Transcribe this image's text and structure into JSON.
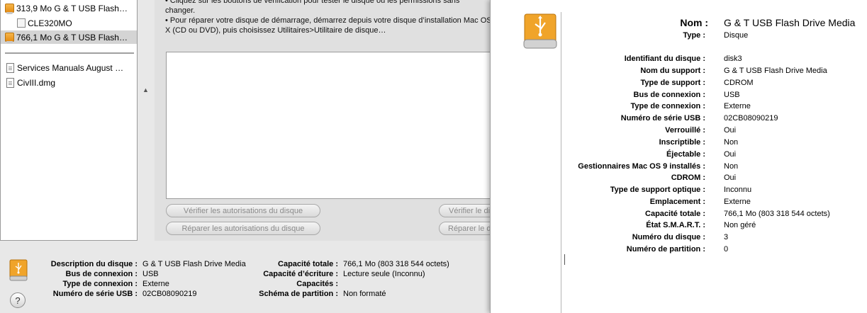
{
  "sidebar": {
    "items": [
      {
        "label": "313,9 Mo G & T USB Flash…",
        "icon": "usb-drive-icon",
        "selected": false
      },
      {
        "label": "CLE320MO",
        "icon": "volume-icon",
        "selected": false
      },
      {
        "label": "766,1 Mo G & T USB Flash…",
        "icon": "usb-drive-icon",
        "selected": true
      },
      {
        "label": "Services Manuals August …",
        "icon": "document-icon",
        "selected": false
      },
      {
        "label": "CivIII.dmg",
        "icon": "disk-image-icon",
        "selected": false
      }
    ]
  },
  "instructions": {
    "line1": "• Cliquez sur les boutons de vérification pour tester le disque ou les permissions sans",
    "line2": "changer.",
    "line3": "• Pour  réparer votre disque de démarrage, démarrez depuis votre disque d’installation Mac OS",
    "line4": "X (CD ou DVD), puis choisissez Utilitaires>Utilitaire de disque…"
  },
  "buttons": {
    "verify_permissions": "Vérifier les autorisations du disque",
    "repair_permissions": "Réparer les autorisations du disque",
    "verify_disk": "Vérifier le disque",
    "repair_disk": "Réparer le disque",
    "help": "?"
  },
  "bottom_info": {
    "description_label": "Description du disque :",
    "description_value": "G & T USB Flash Drive Media",
    "bus_label": "Bus de connexion :",
    "bus_value": "USB",
    "connection_label": "Type de connexion :",
    "connection_value": "Externe",
    "serial_label": "Numéro de série USB :",
    "serial_value": "02CB08090219",
    "capacity_label": "Capacité totale :",
    "capacity_value": "766,1 Mo (803 318 544 octets)",
    "write_label": "Capacité d’écriture :",
    "write_value": "Lecture seule (Inconnu)",
    "capabilities_label": "Capacités :",
    "capabilities_value": "",
    "partition_label": "Schéma de partition :",
    "partition_value": "Non formaté"
  },
  "info_window": {
    "rows": [
      {
        "key": "Nom :",
        "value": "G & T USB Flash Drive Media"
      },
      {
        "key": "Type :",
        "value": "Disque"
      },
      {
        "key": "Identifiant du disque :",
        "value": "disk3"
      },
      {
        "key": "Nom du support :",
        "value": "G & T USB Flash Drive Media"
      },
      {
        "key": "Type de support :",
        "value": "CDROM"
      },
      {
        "key": "Bus de connexion :",
        "value": "USB"
      },
      {
        "key": "Type de connexion :",
        "value": "Externe"
      },
      {
        "key": "Numéro de série USB :",
        "value": "02CB08090219"
      },
      {
        "key": "Verrouillé :",
        "value": "Oui"
      },
      {
        "key": "Inscriptible :",
        "value": "Non"
      },
      {
        "key": "Éjectable :",
        "value": "Oui"
      },
      {
        "key": "Gestionnaires Mac OS 9 installés :",
        "value": "Non"
      },
      {
        "key": "CDROM :",
        "value": "Oui"
      },
      {
        "key": "Type de support optique :",
        "value": "Inconnu"
      },
      {
        "key": "Emplacement :",
        "value": "Externe"
      },
      {
        "key": "Capacité totale :",
        "value": "766,1 Mo (803 318 544 octets)"
      },
      {
        "key": "État S.M.A.R.T. :",
        "value": "Non géré"
      },
      {
        "key": "Numéro du disque :",
        "value": "3"
      },
      {
        "key": "Numéro de partition :",
        "value": "0"
      }
    ]
  },
  "colors": {
    "drive_orange": "#f0a42a",
    "selection_gray": "#d4d4d4"
  }
}
